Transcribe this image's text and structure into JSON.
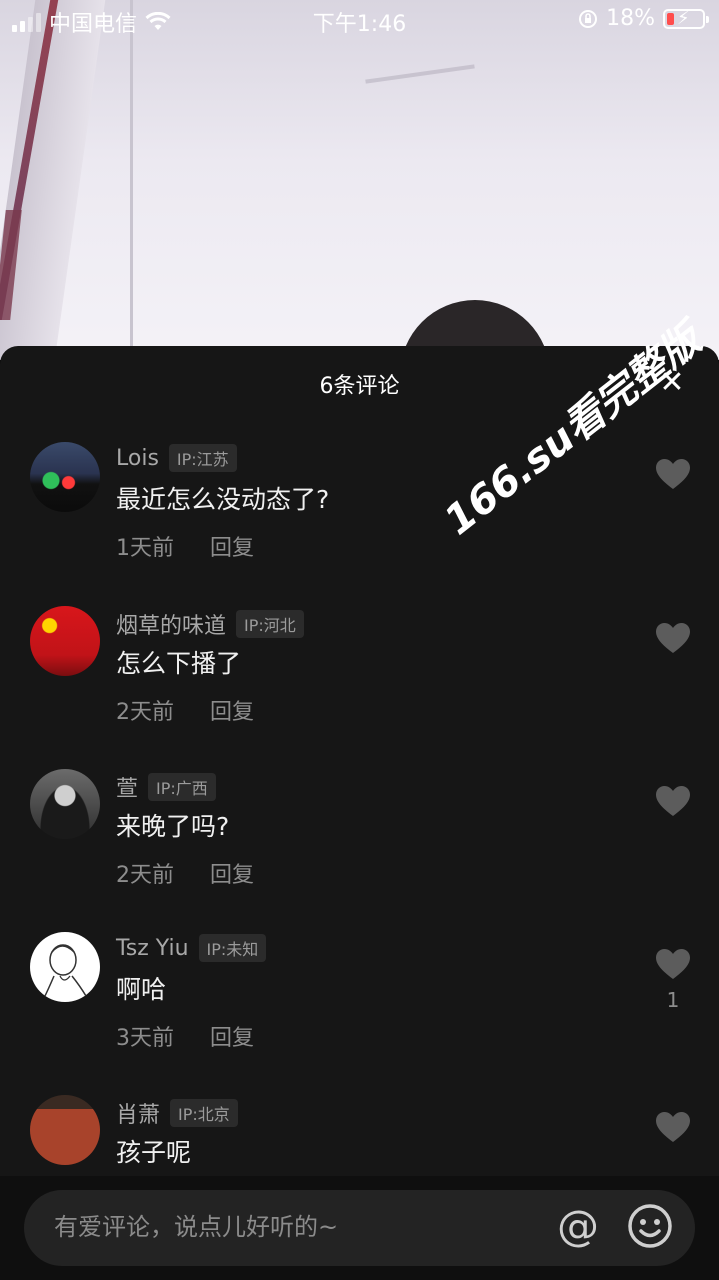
{
  "status_bar": {
    "carrier": "中国电信",
    "time": "下午1:46",
    "battery_percent": "18%",
    "icons": [
      "signal-icon",
      "wifi-icon",
      "rotation-lock-icon",
      "battery-charging-icon"
    ]
  },
  "sheet": {
    "title": "6条评论",
    "close_icon": "close-icon"
  },
  "comments": [
    {
      "username": "Lois",
      "ip": "IP:江苏",
      "text": "最近怎么没动态了?",
      "time": "1天前",
      "reply": "回复",
      "likes": ""
    },
    {
      "username": "烟草的味道",
      "ip": "IP:河北",
      "text": "怎么下播了",
      "time": "2天前",
      "reply": "回复",
      "likes": ""
    },
    {
      "username": "萱",
      "ip": "IP:广西",
      "text": "来晚了吗?",
      "time": "2天前",
      "reply": "回复",
      "likes": ""
    },
    {
      "username": "Tsz Yiu",
      "ip": "IP:未知",
      "text": "啊哈",
      "time": "3天前",
      "reply": "回复",
      "likes": "1"
    },
    {
      "username": "肖萧",
      "ip": "IP:北京",
      "text": "孩子呢",
      "time": "",
      "reply": "",
      "likes": ""
    }
  ],
  "watermark": "166.su看完整版",
  "input": {
    "placeholder": "有爱评论，说点儿好听的~",
    "at_symbol": "@",
    "icons": [
      "at-icon",
      "emoji-icon"
    ]
  },
  "colors": {
    "sheet_bg": "#161616",
    "input_bg": "#232323",
    "text_primary": "#f0f0f0",
    "text_secondary": "#8d8d8d"
  }
}
